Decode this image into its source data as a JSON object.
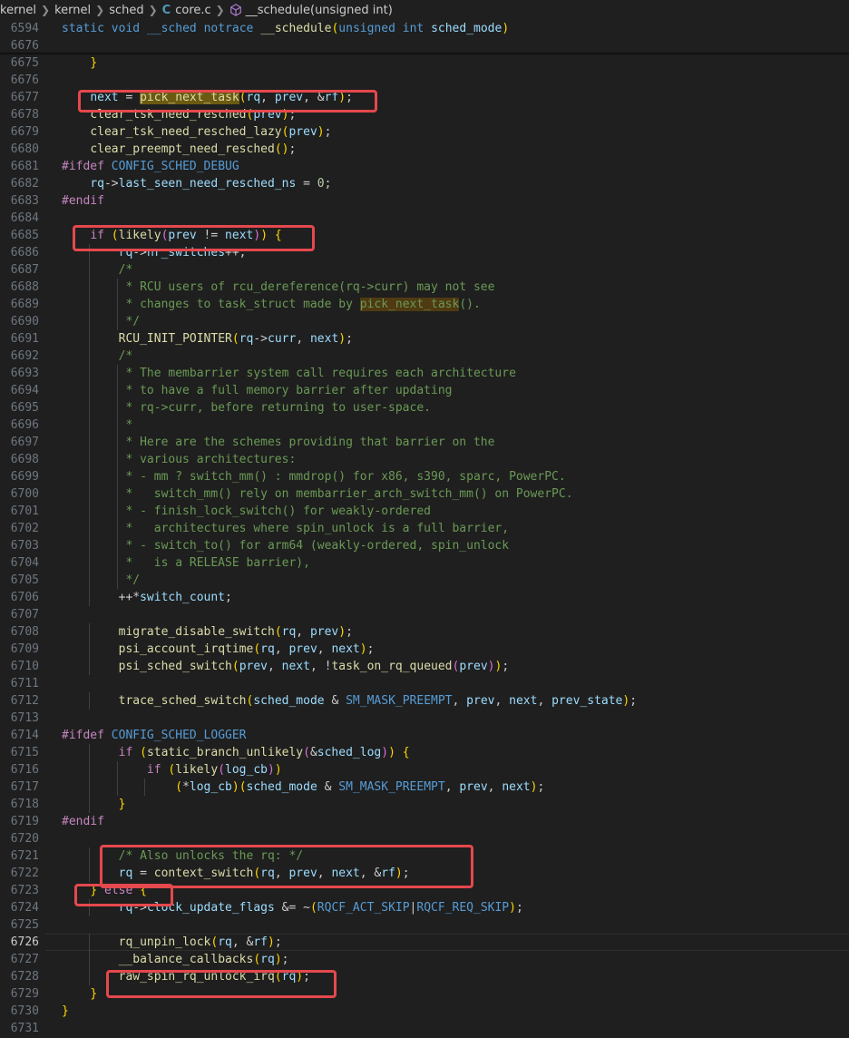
{
  "breadcrumb": {
    "items": [
      "kernel",
      "kernel",
      "sched",
      "core.c",
      "__schedule(unsigned int)"
    ],
    "file_icon": "C"
  },
  "editor": {
    "active_line": "6726",
    "lines": [
      {
        "n": "6594",
        "t": "static void __sched notrace __schedule(unsigned int sched_mode)"
      },
      {
        "n": "6676",
        "t": ""
      },
      {
        "n": "6675",
        "t": "    }"
      },
      {
        "n": "6676",
        "t": ""
      },
      {
        "n": "6677",
        "t": "    next = pick_next_task(rq, prev, &rf);"
      },
      {
        "n": "6678",
        "t": "    clear_tsk_need_resched(prev);"
      },
      {
        "n": "6679",
        "t": "    clear_tsk_need_resched_lazy(prev);"
      },
      {
        "n": "6680",
        "t": "    clear_preempt_need_resched();"
      },
      {
        "n": "6681",
        "t": "#ifdef CONFIG_SCHED_DEBUG"
      },
      {
        "n": "6682",
        "t": "    rq->last_seen_need_resched_ns = 0;"
      },
      {
        "n": "6683",
        "t": "#endif"
      },
      {
        "n": "6684",
        "t": ""
      },
      {
        "n": "6685",
        "t": "    if (likely(prev != next)) {"
      },
      {
        "n": "6686",
        "t": "        rq->nr_switches++;"
      },
      {
        "n": "6687",
        "t": "        /*"
      },
      {
        "n": "6688",
        "t": "         * RCU users of rcu_dereference(rq->curr) may not see"
      },
      {
        "n": "6689",
        "t": "         * changes to task_struct made by pick_next_task()."
      },
      {
        "n": "6690",
        "t": "         */"
      },
      {
        "n": "6691",
        "t": "        RCU_INIT_POINTER(rq->curr, next);"
      },
      {
        "n": "6692",
        "t": "        /*"
      },
      {
        "n": "6693",
        "t": "         * The membarrier system call requires each architecture"
      },
      {
        "n": "6694",
        "t": "         * to have a full memory barrier after updating"
      },
      {
        "n": "6695",
        "t": "         * rq->curr, before returning to user-space."
      },
      {
        "n": "6696",
        "t": "         *"
      },
      {
        "n": "6697",
        "t": "         * Here are the schemes providing that barrier on the"
      },
      {
        "n": "6698",
        "t": "         * various architectures:"
      },
      {
        "n": "6699",
        "t": "         * - mm ? switch_mm() : mmdrop() for x86, s390, sparc, PowerPC."
      },
      {
        "n": "6700",
        "t": "         *   switch_mm() rely on membarrier_arch_switch_mm() on PowerPC."
      },
      {
        "n": "6701",
        "t": "         * - finish_lock_switch() for weakly-ordered"
      },
      {
        "n": "6702",
        "t": "         *   architectures where spin_unlock is a full barrier,"
      },
      {
        "n": "6703",
        "t": "         * - switch_to() for arm64 (weakly-ordered, spin_unlock"
      },
      {
        "n": "6704",
        "t": "         *   is a RELEASE barrier),"
      },
      {
        "n": "6705",
        "t": "         */"
      },
      {
        "n": "6706",
        "t": "        ++*switch_count;"
      },
      {
        "n": "6707",
        "t": ""
      },
      {
        "n": "6708",
        "t": "        migrate_disable_switch(rq, prev);"
      },
      {
        "n": "6709",
        "t": "        psi_account_irqtime(rq, prev, next);"
      },
      {
        "n": "6710",
        "t": "        psi_sched_switch(prev, next, !task_on_rq_queued(prev));"
      },
      {
        "n": "6711",
        "t": ""
      },
      {
        "n": "6712",
        "t": "        trace_sched_switch(sched_mode & SM_MASK_PREEMPT, prev, next, prev_state);"
      },
      {
        "n": "6713",
        "t": ""
      },
      {
        "n": "6714",
        "t": "#ifdef CONFIG_SCHED_LOGGER"
      },
      {
        "n": "6715",
        "t": "        if (static_branch_unlikely(&sched_log)) {"
      },
      {
        "n": "6716",
        "t": "            if (likely(log_cb))"
      },
      {
        "n": "6717",
        "t": "                (*log_cb)(sched_mode & SM_MASK_PREEMPT, prev, next);"
      },
      {
        "n": "6718",
        "t": "        }"
      },
      {
        "n": "6719",
        "t": "#endif"
      },
      {
        "n": "6720",
        "t": ""
      },
      {
        "n": "6721",
        "t": "        /* Also unlocks the rq: */"
      },
      {
        "n": "6722",
        "t": "        rq = context_switch(rq, prev, next, &rf);"
      },
      {
        "n": "6723",
        "t": "    } else {"
      },
      {
        "n": "6724",
        "t": "        rq->clock_update_flags &= ~(RQCF_ACT_SKIP|RQCF_REQ_SKIP);"
      },
      {
        "n": "6725",
        "t": ""
      },
      {
        "n": "6726",
        "t": "        rq_unpin_lock(rq, &rf);"
      },
      {
        "n": "6727",
        "t": "        __balance_callbacks(rq);"
      },
      {
        "n": "6728",
        "t": "        raw_spin_rq_unlock_irq(rq);"
      },
      {
        "n": "6729",
        "t": "    }"
      },
      {
        "n": "6730",
        "t": "}"
      },
      {
        "n": "6731",
        "t": ""
      }
    ]
  },
  "colors": {
    "background": "#1f1f1f",
    "annotation": "#e5484d",
    "keyword": "#569cd6",
    "function": "#dcdcaa",
    "variable": "#9cdcfe",
    "comment": "#6a9955"
  }
}
